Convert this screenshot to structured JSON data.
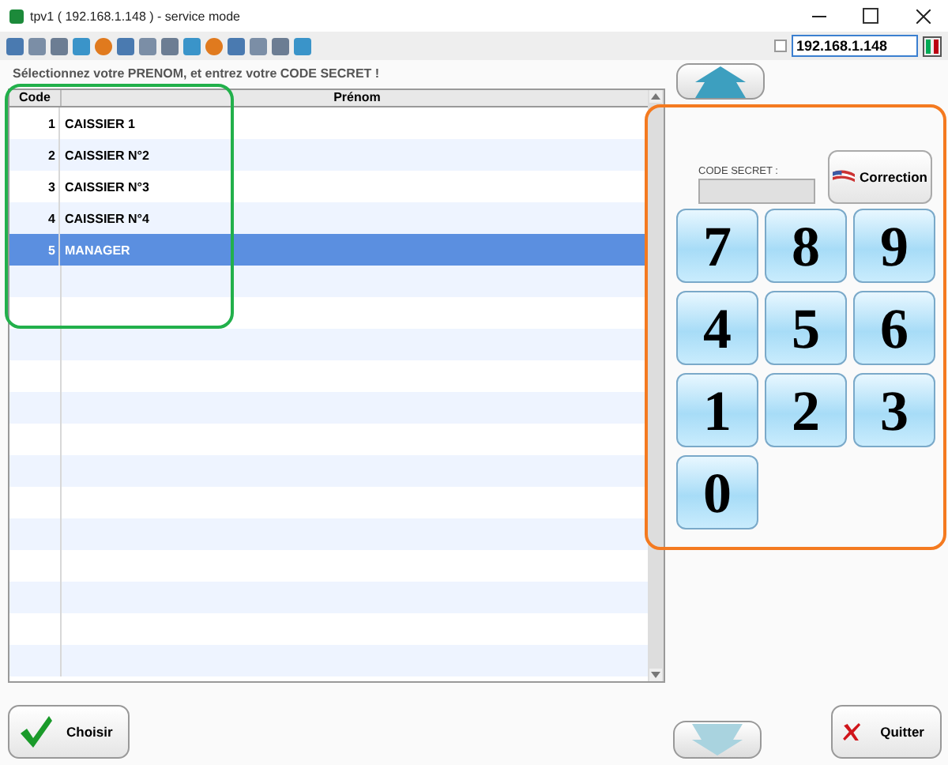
{
  "window": {
    "title": "tpv1 ( 192.168.1.148 ) - service mode"
  },
  "option_checkbox": {
    "checked": false
  },
  "address_field": {
    "value": "192.168.1.148"
  },
  "instruction": "Sélectionnez votre PRENOM, et entrez votre CODE SECRET !",
  "table": {
    "columns": [
      "Code",
      "Prénom"
    ],
    "rows": [
      {
        "code": "1",
        "name": "CAISSIER 1",
        "selected": false
      },
      {
        "code": "2",
        "name": "CAISSIER N°2",
        "selected": false
      },
      {
        "code": "3",
        "name": "CAISSIER N°3",
        "selected": false
      },
      {
        "code": "4",
        "name": "CAISSIER N°4",
        "selected": false
      },
      {
        "code": "5",
        "name": "MANAGER",
        "selected": true
      }
    ]
  },
  "keypad": {
    "code_label": "CODE SECRET :",
    "correction_button": "Correction",
    "keys": [
      "7",
      "8",
      "9",
      "4",
      "5",
      "6",
      "1",
      "2",
      "3",
      "0"
    ]
  },
  "buttons": {
    "choose": "Choisir",
    "quit": "Quitter"
  },
  "annotations": [
    {
      "color": "#22b04b"
    },
    {
      "color": "#f47a20"
    }
  ]
}
